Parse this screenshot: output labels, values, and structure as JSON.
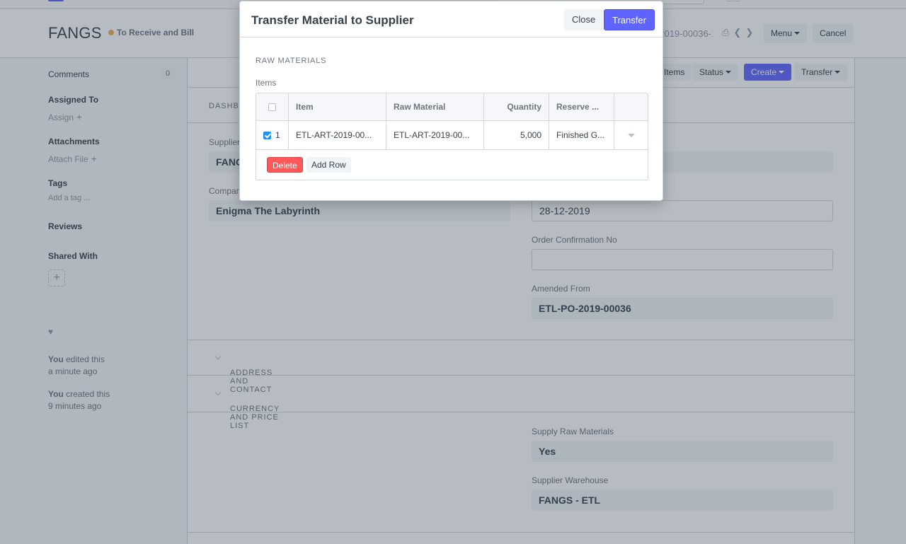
{
  "page": {
    "title": "FANGS",
    "status": "To Receive and Bill",
    "doc_name": "ETL-PO-2019-00036-1",
    "menu_label": "Menu",
    "cancel_label": "Cancel",
    "toolbar": {
      "items_label": "Items",
      "status_label": "Status",
      "create_label": "Create",
      "transfer_label": "Transfer"
    },
    "tab_dashboard": "DASHBOARD"
  },
  "sidebar": {
    "comments_label": "Comments",
    "comments_count": "0",
    "assigned_to_label": "Assigned To",
    "assign_link": "Assign",
    "attachments_label": "Attachments",
    "attach_link": "Attach File",
    "tags_label": "Tags",
    "add_tag_link": "Add a tag ...",
    "reviews_label": "Reviews",
    "shared_with_label": "Shared With",
    "activity": [
      {
        "user": "You",
        "action": " edited this",
        "time": "a minute ago"
      },
      {
        "user": "You",
        "action": " created this",
        "time": "9 minutes ago"
      }
    ]
  },
  "form": {
    "supplier_label": "Supplier",
    "supplier_value": "FANGS",
    "company_label": "Company",
    "company_value": "Enigma The Labyrinth",
    "date_value": "28-12-2019",
    "order_confirmation_label": "Order Confirmation No",
    "order_confirmation_value": "",
    "amended_from_label": "Amended From",
    "amended_from_value": "ETL-PO-2019-00036",
    "section_address": "ADDRESS AND CONTACT",
    "section_currency": "CURRENCY AND PRICE LIST",
    "supply_raw_label": "Supply Raw Materials",
    "supply_raw_value": "Yes",
    "supplier_warehouse_label": "Supplier Warehouse",
    "supplier_warehouse_value": "FANGS - ETL"
  },
  "modal": {
    "title": "Transfer Material to Supplier",
    "close_label": "Close",
    "transfer_label": "Transfer",
    "section_label": "RAW MATERIALS",
    "items_label": "Items",
    "columns": [
      "Item",
      "Raw Material",
      "Quantity",
      "Reserve ..."
    ],
    "rows": [
      {
        "idx": "1",
        "checked": true,
        "item": "ETL-ART-2019-00...",
        "raw_material": "ETL-ART-2019-00...",
        "quantity": "5,000",
        "reserve": "Finished G..."
      }
    ],
    "delete_label": "Delete",
    "add_row_label": "Add Row"
  },
  "colors": {
    "primary": "#5e64ff",
    "danger": "#ff5858",
    "status_dot": "#f0ad4e",
    "checkbox": "#2490ef"
  }
}
